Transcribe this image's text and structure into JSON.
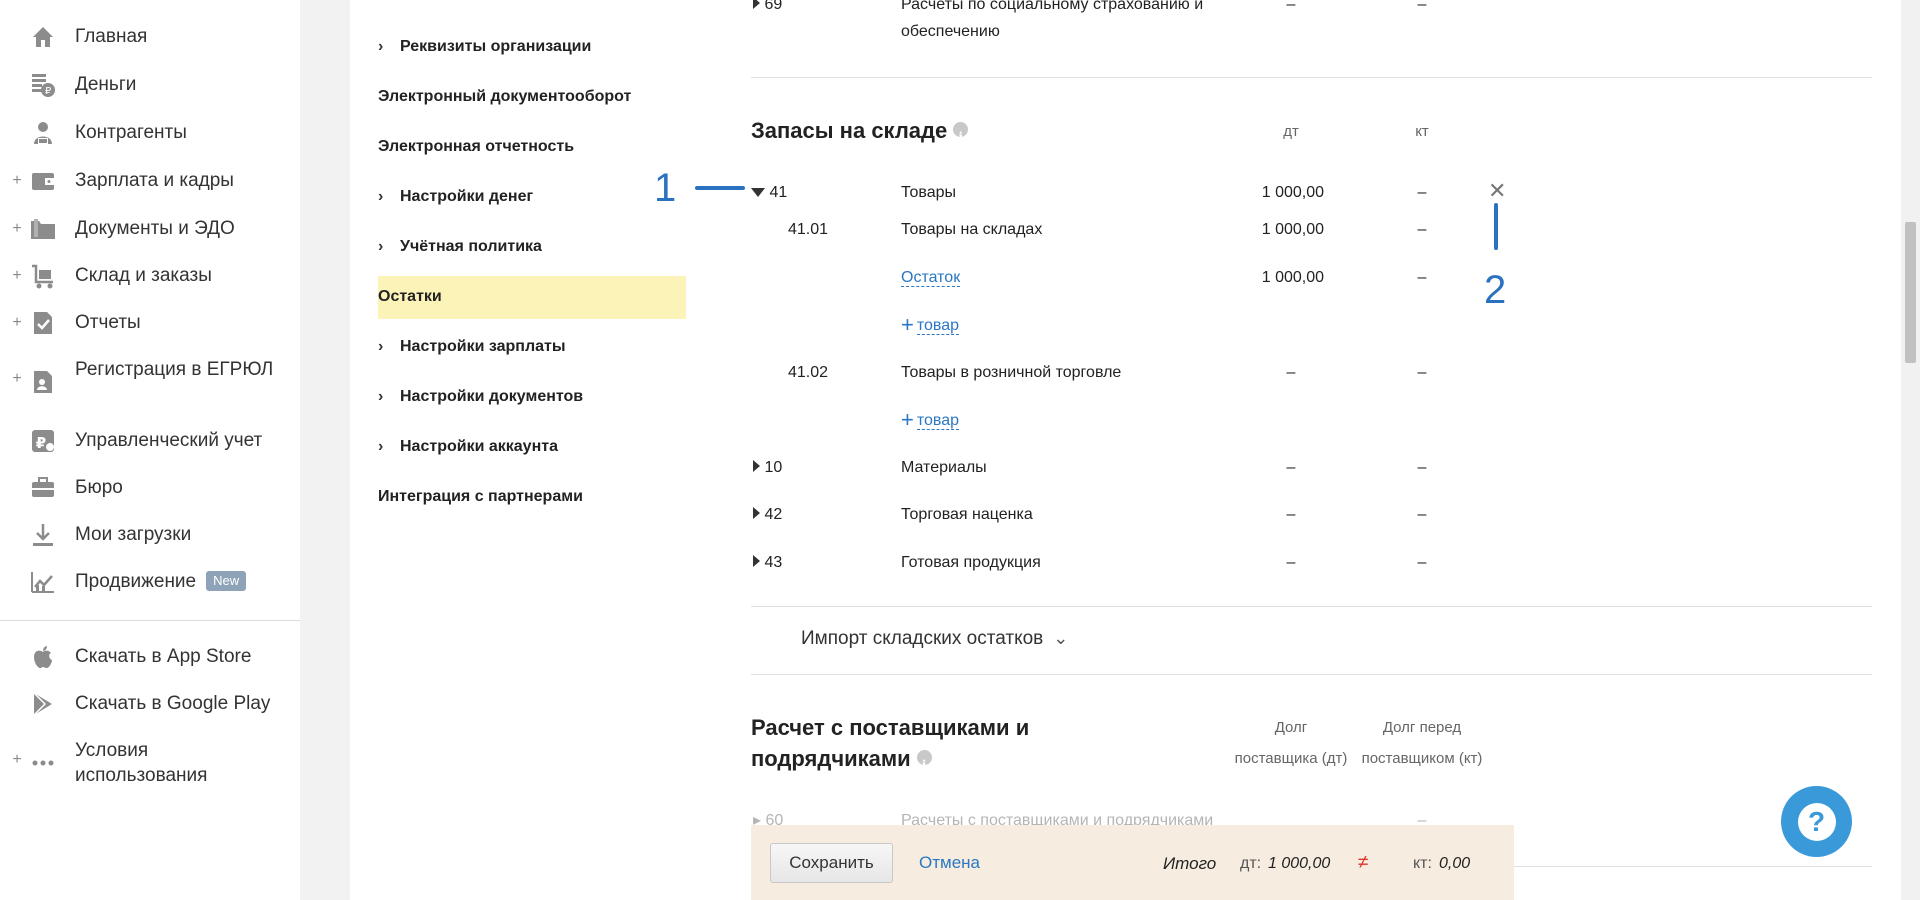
{
  "nav": {
    "items": [
      {
        "label": "Главная",
        "plus": "",
        "icon": "home-icon"
      },
      {
        "label": "Деньги",
        "plus": "",
        "icon": "money-icon"
      },
      {
        "label": "Контрагенты",
        "plus": "",
        "icon": "contractors-icon"
      },
      {
        "label": "Зарплата и кадры",
        "plus": "+",
        "icon": "wallet-icon"
      },
      {
        "label": "Документы и ЭДО",
        "plus": "+",
        "icon": "folder-icon"
      },
      {
        "label": "Склад и заказы",
        "plus": "+",
        "icon": "cart-icon"
      },
      {
        "label": "Отчеты",
        "plus": "+",
        "icon": "report-check-icon"
      },
      {
        "label": "Регистрация в ЕГРЮЛ",
        "plus": "+",
        "icon": "registration-icon"
      },
      {
        "label": "Управленческий учет",
        "plus": "",
        "icon": "management-icon"
      },
      {
        "label": "Бюро",
        "plus": "",
        "icon": "briefcase-icon"
      },
      {
        "label": "Мои загрузки",
        "plus": "",
        "icon": "download-icon"
      },
      {
        "label": "Продвижение",
        "plus": "",
        "icon": "promotion-icon",
        "badge": "New"
      }
    ],
    "bottom_items": [
      {
        "label": "Скачать в App Store",
        "plus": "",
        "icon": "apple-icon"
      },
      {
        "label": "Скачать в Google Play",
        "plus": "",
        "icon": "google-play-icon"
      },
      {
        "label": "Условия использования",
        "plus": "+",
        "icon": "more-dots-icon"
      }
    ]
  },
  "submenu": {
    "items": [
      {
        "label": "Реквизиты организации",
        "chevron": "›"
      },
      {
        "label": "Электронный документооборот",
        "chevron": ""
      },
      {
        "label": "Электронная отчетность",
        "chevron": ""
      },
      {
        "label": "Настройки денег",
        "chevron": "›"
      },
      {
        "label": "Учётная политика",
        "chevron": "›"
      },
      {
        "label": "Остатки",
        "chevron": "",
        "active": true
      },
      {
        "label": "Настройки зарплаты",
        "chevron": "›"
      },
      {
        "label": "Настройки документов",
        "chevron": "›"
      },
      {
        "label": "Настройки аккаунта",
        "chevron": "›"
      },
      {
        "label": "Интеграция с партнерами",
        "chevron": ""
      }
    ]
  },
  "top_partial": {
    "code": "69",
    "name_line1": "Расчеты по социальному страхованию и",
    "name_line2": "обеспечению",
    "dt": "–",
    "kt": "–"
  },
  "stock": {
    "title": "Запасы на складе",
    "col_dt": "дт",
    "col_kt": "кт",
    "rows": [
      {
        "code": "41",
        "name": "Товары",
        "dt": "1 000,00",
        "kt": "–"
      },
      {
        "code": "41.01",
        "name": "Товары на складах",
        "dt": "1 000,00",
        "kt": "–"
      },
      {
        "code": "",
        "name": "Остаток",
        "dt": "1 000,00",
        "kt": "–"
      },
      {
        "code": "41.02",
        "name": "Товары в розничной торговле",
        "dt": "–",
        "kt": "–"
      },
      {
        "code": "10",
        "name": "Материалы",
        "dt": "–",
        "kt": "–"
      },
      {
        "code": "42",
        "name": "Торговая наценка",
        "dt": "–",
        "kt": "–"
      },
      {
        "code": "43",
        "name": "Готовая продукция",
        "dt": "–",
        "kt": "–"
      }
    ],
    "add_item_plus": "+",
    "add_item_label": "товар",
    "import_label": "Импорт складских остатков",
    "import_chevron": "⌄",
    "close_symbol": "✕"
  },
  "suppliers": {
    "title_line1": "Расчет с поставщиками и",
    "title_line2": "подрядчиками",
    "col1_line1": "Долг",
    "col1_line2": "поставщика (дт)",
    "col2_line1": "Долг перед",
    "col2_line2": "поставщиком (кт)",
    "faded_code": "60",
    "faded_name": "Расчеты с поставщиками и подрядчиками",
    "faded_kt": "–"
  },
  "annotations": {
    "one": "1",
    "two": "2"
  },
  "footer": {
    "save_label": "Сохранить",
    "cancel_label": "Отмена",
    "total_label": "Итого",
    "dt_key": "дт:",
    "dt_value": "1 000,00",
    "neq_symbol": "≠",
    "kt_key": "кт:",
    "kt_value": "0,00"
  },
  "help_symbol": "?"
}
